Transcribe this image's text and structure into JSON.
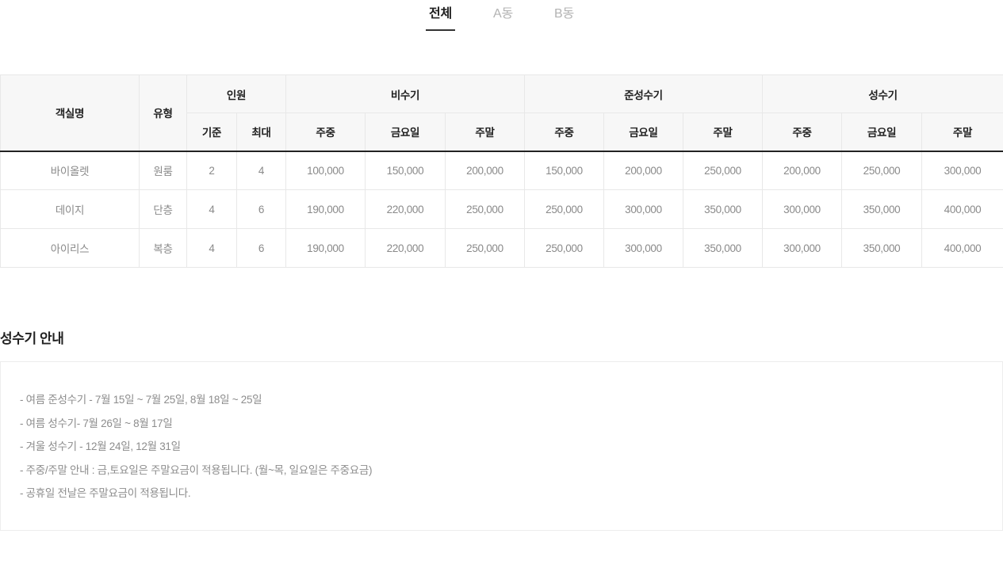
{
  "tabs": [
    {
      "label": "전체",
      "active": true
    },
    {
      "label": "A동",
      "active": false
    },
    {
      "label": "B동",
      "active": false
    }
  ],
  "table": {
    "headers": {
      "room_name": "객실명",
      "room_type": "유형",
      "capacity": "인원",
      "capacity_standard": "기준",
      "capacity_max": "최대",
      "seasons": [
        {
          "name": "비수기",
          "sub": [
            "주중",
            "금요일",
            "주말"
          ]
        },
        {
          "name": "준성수기",
          "sub": [
            "주중",
            "금요일",
            "주말"
          ]
        },
        {
          "name": "성수기",
          "sub": [
            "주중",
            "금요일",
            "주말"
          ]
        }
      ]
    },
    "rows": [
      {
        "name": "바이올렛",
        "type": "원룸",
        "standard": "2",
        "max": "4",
        "low_weekday": "100,000",
        "low_friday": "150,000",
        "low_weekend": "200,000",
        "mid_weekday": "150,000",
        "mid_friday": "200,000",
        "mid_weekend": "250,000",
        "high_weekday": "200,000",
        "high_friday": "250,000",
        "high_weekend": "300,000"
      },
      {
        "name": "데이지",
        "type": "단층",
        "standard": "4",
        "max": "6",
        "low_weekday": "190,000",
        "low_friday": "220,000",
        "low_weekend": "250,000",
        "mid_weekday": "250,000",
        "mid_friday": "300,000",
        "mid_weekend": "350,000",
        "high_weekday": "300,000",
        "high_friday": "350,000",
        "high_weekend": "400,000"
      },
      {
        "name": "아이리스",
        "type": "복층",
        "standard": "4",
        "max": "6",
        "low_weekday": "190,000",
        "low_friday": "220,000",
        "low_weekend": "250,000",
        "mid_weekday": "250,000",
        "mid_friday": "300,000",
        "mid_weekend": "350,000",
        "high_weekday": "300,000",
        "high_friday": "350,000",
        "high_weekend": "400,000"
      }
    ]
  },
  "notice": {
    "title": "성수기 안내",
    "lines": [
      "- 여름 준성수기 - 7월 15일 ~ 7월 25일, 8월 18일 ~ 25일",
      "- 여름 성수기- 7월 26일 ~ 8월 17일",
      "- 겨울 성수기 - 12월 24일, 12월 31일",
      "- 주중/주말 안내 : 금,토요일은 주말요금이 적용됩니다. (월~목, 일요일은 주중요금)",
      "- 공휴일 전날은 주말요금이 적용됩니다."
    ]
  },
  "colors": {
    "accent": "#333333",
    "header_bg": "#f7f7f7",
    "border": "#e8e8e8",
    "text_primary": "#222222",
    "text_muted": "#8a8a8a",
    "tab_inactive": "#b3b3b3"
  }
}
